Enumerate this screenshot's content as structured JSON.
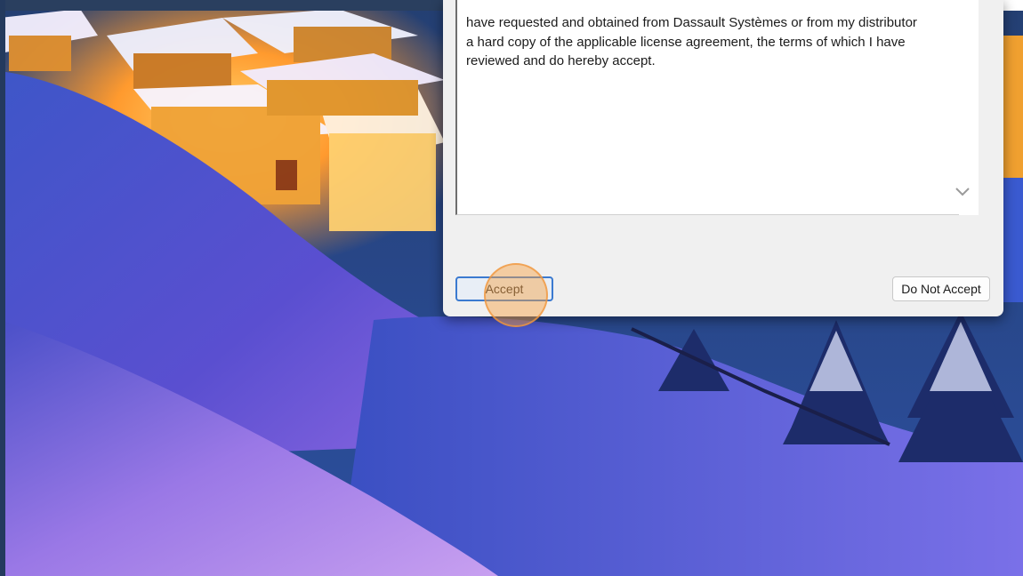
{
  "license": {
    "text": "have requested and obtained from Dassault Systèmes or from my distributor\na hard copy of the applicable license agreement, the terms of which I have\nreviewed and do hereby accept."
  },
  "buttons": {
    "accept_label": "Accept",
    "decline_label": "Do Not Accept"
  },
  "icons": {
    "scroll_down": "chevron-down-icon",
    "click_marker": "click-highlight"
  },
  "colors": {
    "accent_border": "#3b7ad0",
    "click_highlight": "#f7a040"
  }
}
